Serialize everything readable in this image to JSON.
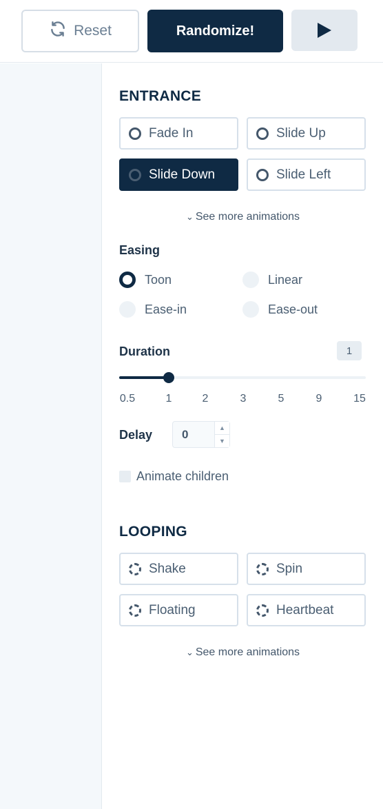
{
  "toolbar": {
    "reset_label": "Reset",
    "randomize_label": "Randomize!",
    "play_icon": "play-icon",
    "reset_icon": "refresh-icon"
  },
  "entrance": {
    "title": "ENTRANCE",
    "options": [
      {
        "label": "Fade In",
        "selected": false
      },
      {
        "label": "Slide Up",
        "selected": false
      },
      {
        "label": "Slide Down",
        "selected": true
      },
      {
        "label": "Slide Left",
        "selected": false
      }
    ],
    "see_more": "See more animations"
  },
  "easing": {
    "label": "Easing",
    "options": [
      {
        "label": "Toon",
        "selected": true
      },
      {
        "label": "Linear",
        "selected": false
      },
      {
        "label": "Ease-in",
        "selected": false
      },
      {
        "label": "Ease-out",
        "selected": false
      }
    ]
  },
  "duration": {
    "label": "Duration",
    "value": "1",
    "ticks": [
      "0.5",
      "1",
      "2",
      "3",
      "5",
      "9",
      "15"
    ]
  },
  "delay": {
    "label": "Delay",
    "value": "0"
  },
  "animate_children": {
    "label": "Animate children",
    "checked": false
  },
  "looping": {
    "title": "LOOPING",
    "options": [
      {
        "label": "Shake"
      },
      {
        "label": "Spin"
      },
      {
        "label": "Floating"
      },
      {
        "label": "Heartbeat"
      }
    ],
    "see_more": "See more animations"
  },
  "colors": {
    "primary": "#0f2a44",
    "border": "#d6e0ea",
    "muted_text": "#4a5e72",
    "sidebar_bg": "#f4f8fb"
  }
}
